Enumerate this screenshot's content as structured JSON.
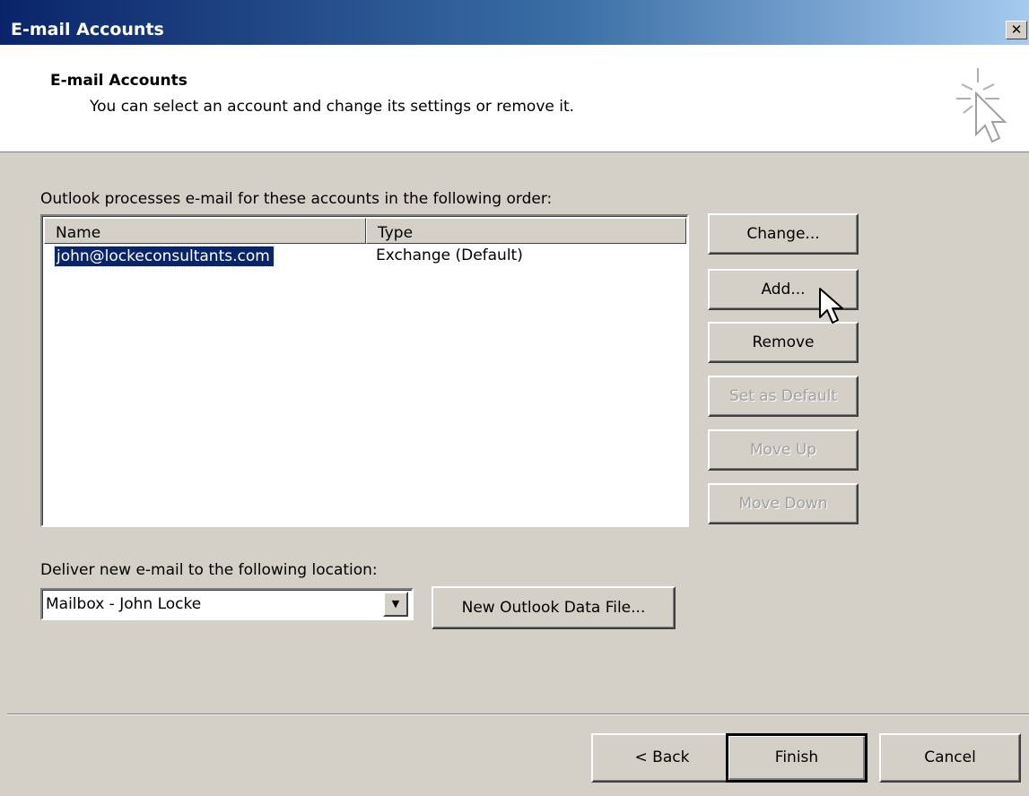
{
  "window": {
    "title": "E-mail Accounts",
    "close_glyph": "✕"
  },
  "header": {
    "title": "E-mail Accounts",
    "subtitle": "You can select an account and change its settings or remove it.",
    "icon": "wizard-cursor-icon"
  },
  "accounts": {
    "order_label": "Outlook processes e-mail for these accounts in the following order:",
    "columns": [
      "Name",
      "Type"
    ],
    "rows": [
      {
        "name": "john@lockeconsultants.com",
        "type": "Exchange (Default)",
        "selected": true
      }
    ]
  },
  "side_buttons": {
    "change": "Change...",
    "add": "Add...",
    "remove": "Remove",
    "set_default": "Set as Default",
    "move_up": "Move Up",
    "move_down": "Move Down"
  },
  "delivery": {
    "label": "Deliver new e-mail to the following location:",
    "selected": "Mailbox - John Locke",
    "new_data_file": "New Outlook Data File..."
  },
  "footer": {
    "back": "< Back",
    "finish": "Finish",
    "cancel": "Cancel"
  },
  "colors": {
    "title_gradient_start": "#0a246a",
    "title_gradient_end": "#a6caf0",
    "dialog_bg": "#d4d0c8",
    "selection_bg": "#0a246a"
  }
}
